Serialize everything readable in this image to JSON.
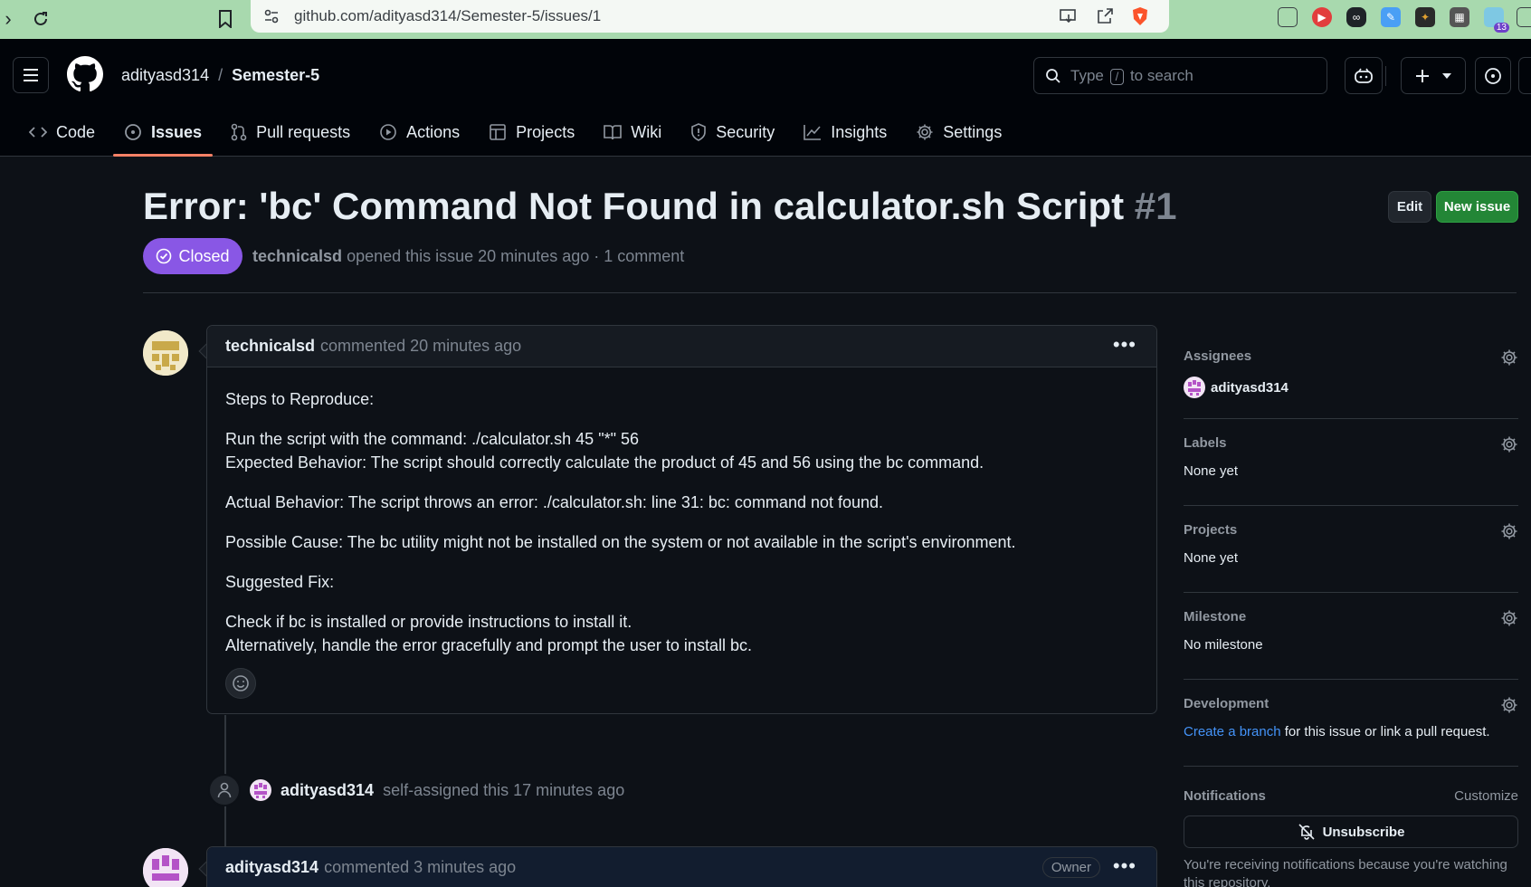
{
  "browser": {
    "url": "github.com/adityasd314/Semester-5/issues/1",
    "ext_badge_count": "13"
  },
  "header": {
    "owner": "adityasd314",
    "separator": "/",
    "repo": "Semester-5",
    "search": {
      "prefix": "Type",
      "key": "/",
      "suffix": "to search"
    }
  },
  "tabs": [
    {
      "label": "Code",
      "icon": "code-icon"
    },
    {
      "label": "Issues",
      "icon": "issue-opened-icon",
      "active": true
    },
    {
      "label": "Pull requests",
      "icon": "git-pull-request-icon"
    },
    {
      "label": "Actions",
      "icon": "play-icon"
    },
    {
      "label": "Projects",
      "icon": "table-icon"
    },
    {
      "label": "Wiki",
      "icon": "book-icon"
    },
    {
      "label": "Security",
      "icon": "shield-icon"
    },
    {
      "label": "Insights",
      "icon": "graph-icon"
    },
    {
      "label": "Settings",
      "icon": "gear-icon"
    }
  ],
  "issue": {
    "title": "Error: 'bc' Command Not Found in calculator.sh Script",
    "number": "#1",
    "state": "Closed",
    "author": "technicalsd",
    "meta_text": "opened this issue 20 minutes ago · 1 comment",
    "edit_label": "Edit",
    "new_issue_label": "New issue"
  },
  "comments": [
    {
      "author": "technicalsd",
      "time_text": "commented 20 minutes ago",
      "body": {
        "p1": "Steps to Reproduce:",
        "p2a": "Run the script with the command: ./calculator.sh 45 \"*\" 56",
        "p2b": "Expected Behavior: The script should correctly calculate the product of 45 and 56 using the bc command.",
        "p3": "Actual Behavior: The script throws an error: ./calculator.sh: line 31: bc: command not found.",
        "p4": "Possible Cause: The bc utility might not be installed on the system or not available in the script's environment.",
        "p5": "Suggested Fix:",
        "p6a": "Check if bc is installed or provide instructions to install it.",
        "p6b": "Alternatively, handle the error gracefully and prompt the user to install bc."
      }
    },
    {
      "author": "adityasd314",
      "time_text": "commented 3 minutes ago",
      "badge": "Owner"
    }
  ],
  "event": {
    "actor": "adityasd314",
    "text": "self-assigned this 17 minutes ago"
  },
  "sidebar": {
    "assignees": {
      "title": "Assignees",
      "value": "adityasd314"
    },
    "labels": {
      "title": "Labels",
      "value": "None yet"
    },
    "projects": {
      "title": "Projects",
      "value": "None yet"
    },
    "milestone": {
      "title": "Milestone",
      "value": "No milestone"
    },
    "development": {
      "title": "Development",
      "link": "Create a branch",
      "rest": "for this issue or link a pull request."
    },
    "notifications": {
      "title": "Notifications",
      "customize": "Customize",
      "unsubscribe": "Unsubscribe",
      "note": "You're receiving notifications because you're watching this repository."
    }
  },
  "colors": {
    "closed": "#8957e5",
    "new_issue": "#238636",
    "active_tab": "#f78166",
    "link": "#4493f8"
  }
}
